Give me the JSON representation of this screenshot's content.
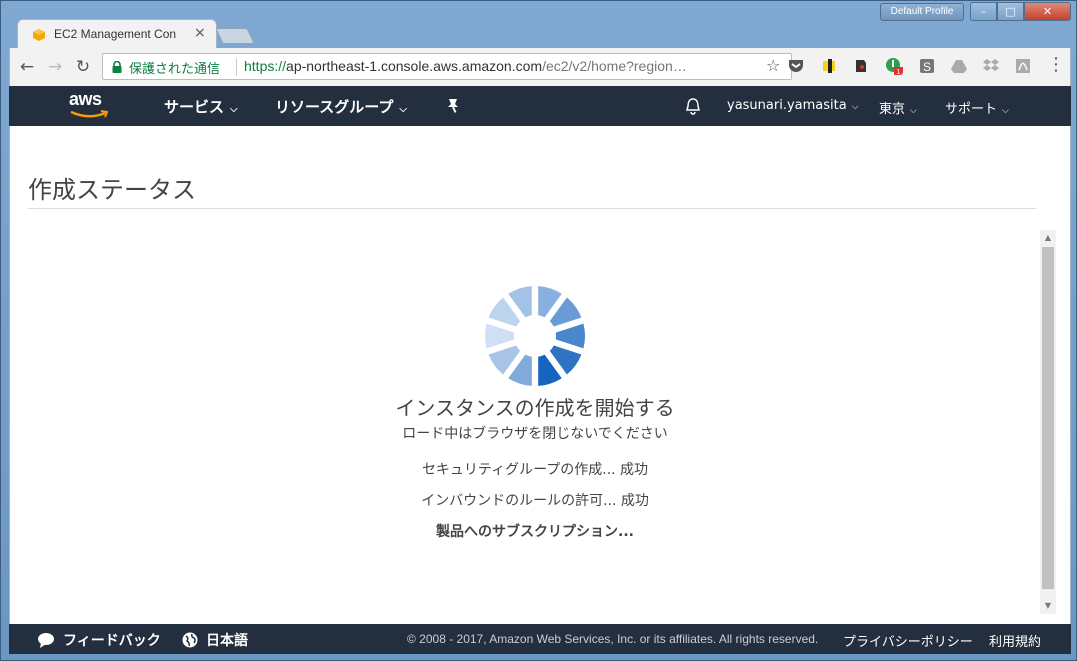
{
  "browser": {
    "profile": "Default Profile",
    "tab_title": "EC2 Management Con",
    "security_label": "保護された通信",
    "url_scheme": "https://",
    "url_host": "ap-northeast-1.console.aws.amazon.com",
    "url_path": "/ec2/v2/home?region…",
    "extension_badge": "1"
  },
  "aws_nav": {
    "logo": "aws",
    "services": "サービス",
    "resource_groups": "リソースグループ",
    "user": "yasunari.yamasita",
    "region": "東京",
    "support": "サポート"
  },
  "main": {
    "page_title": "作成ステータス",
    "status_heading": "インスタンスの作成を開始する",
    "status_sub": "ロード中はブラウザを閉じないでください",
    "steps": [
      "セキュリティグループの作成... 成功",
      "インバウンドのルールの許可... 成功",
      "製品へのサブスクリプション..."
    ]
  },
  "footer": {
    "feedback": "フィードバック",
    "language": "日本語",
    "copyright": "© 2008 - 2017, Amazon Web Services, Inc. or its affiliates. All rights reserved.",
    "privacy": "プライバシーポリシー",
    "terms": "利用規約"
  },
  "colors": {
    "nav_bg": "#232f3e",
    "secure_green": "#0b8043",
    "spinner_blue": "#1565c0"
  },
  "icons": [
    "back-icon",
    "forward-icon",
    "reload-icon",
    "lock-icon",
    "star-icon",
    "bell-icon",
    "pin-icon",
    "chat-icon",
    "globe-icon",
    "menu-icon"
  ]
}
